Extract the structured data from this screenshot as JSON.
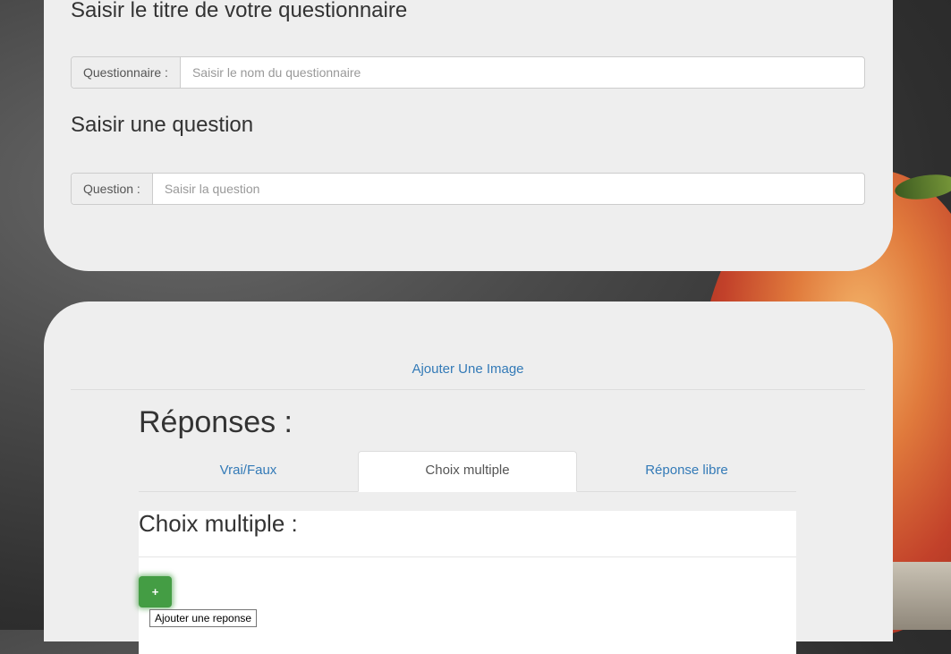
{
  "questionnaire_section": {
    "title": "Saisir le titre de votre questionnaire",
    "label": "Questionnaire :",
    "placeholder": "Saisir le nom du questionnaire"
  },
  "question_section": {
    "title": "Saisir une question",
    "label": "Question :",
    "placeholder": "Saisir la question"
  },
  "add_image_link": "Ajouter Une Image",
  "responses": {
    "title": "Réponses :",
    "tabs": [
      {
        "label": "Vrai/Faux",
        "active": false
      },
      {
        "label": "Choix multiple",
        "active": true
      },
      {
        "label": "Réponse libre",
        "active": false
      }
    ],
    "choice_panel_title": "Choix multiple :",
    "add_button_label": "+",
    "add_button_tooltip": "Ajouter une reponse"
  }
}
